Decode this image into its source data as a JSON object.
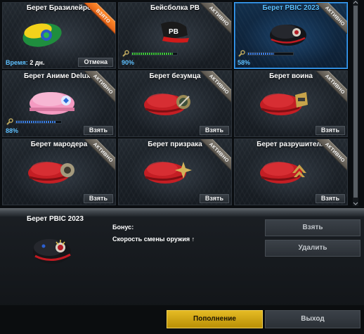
{
  "items": [
    {
      "title": "Берет Бразилейро",
      "badge": "ВЗЯТО",
      "badge_type": "taken",
      "time_label": "Время:",
      "time_value": "2 дн.",
      "action": "Отмена",
      "icon": "brazil-beret-icon",
      "color": "#2fb64a"
    },
    {
      "title": "Бейсболка PB",
      "badge": "АКТИВНО",
      "badge_type": "active",
      "progress_pct": "90%",
      "progress": 0.9,
      "bar_color": "#40c53a",
      "action": "",
      "icon": "pb-cap-icon",
      "color": "#1a1a1a"
    },
    {
      "title": "Берет PBIC 2023",
      "badge": "АКТИВНО",
      "badge_type": "active",
      "progress_pct": "58%",
      "progress": 0.58,
      "bar_color": "#3d7ee0",
      "action": "",
      "icon": "pbic-beret-icon",
      "color": "#16171c",
      "selected": true
    },
    {
      "title": "Берет Аниме Deluxe",
      "badge": "АКТИВНО",
      "badge_type": "active",
      "progress_pct": "88%",
      "progress": 0.88,
      "bar_color": "#3d7ee0",
      "action": "Взять",
      "icon": "anime-beret-icon",
      "color": "#f49ac1"
    },
    {
      "title": "Берет безумца",
      "badge": "АКТИВНО",
      "badge_type": "active",
      "action": "Взять",
      "icon": "madman-beret-icon",
      "color": "#c41e24"
    },
    {
      "title": "Берет воина",
      "badge": "АКТИВНО",
      "badge_type": "active",
      "action": "Взять",
      "icon": "warrior-beret-icon",
      "color": "#c41e24"
    },
    {
      "title": "Берет мародера",
      "badge": "АКТИВНО",
      "badge_type": "active",
      "action": "Взять",
      "icon": "marauder-beret-icon",
      "color": "#c41e24"
    },
    {
      "title": "Берет призрака",
      "badge": "АКТИВНО",
      "badge_type": "active",
      "action": "Взять",
      "icon": "ghost-beret-icon",
      "color": "#c41e24"
    },
    {
      "title": "Берет разрушителя",
      "badge": "АКТИВНО",
      "badge_type": "active",
      "action": "Взять",
      "icon": "destroyer-beret-icon",
      "color": "#c41e24"
    }
  ],
  "detail": {
    "title": "Берет PBIC 2023",
    "bonus_label": "Бонус:",
    "bonus_value": "Скорость смены оружия ↑"
  },
  "buttons": {
    "take": "Взять",
    "delete": "Удалить",
    "refill": "Пополнение",
    "exit": "Выход"
  }
}
